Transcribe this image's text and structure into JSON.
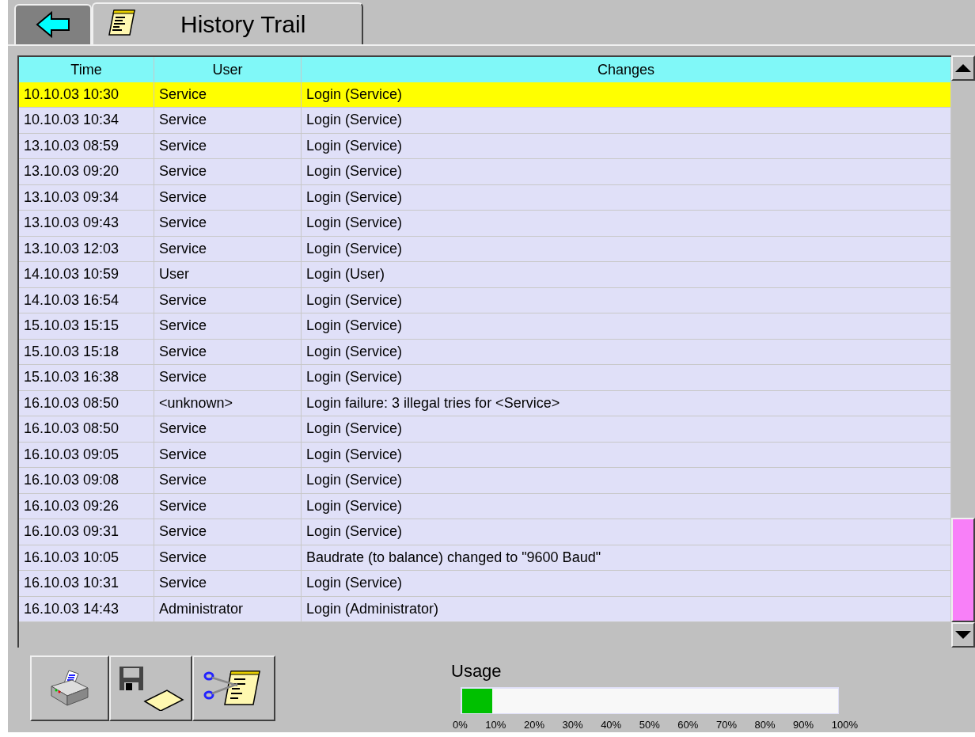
{
  "title_tab": {
    "label": "History Trail"
  },
  "table": {
    "columns": [
      "Time",
      "User",
      "Changes"
    ],
    "rows": [
      {
        "time": "10.10.03 10:30",
        "user": "Service",
        "changes": "Login (Service)",
        "selected": true
      },
      {
        "time": "10.10.03 10:34",
        "user": "Service",
        "changes": "Login (Service)",
        "selected": false
      },
      {
        "time": "13.10.03 08:59",
        "user": "Service",
        "changes": "Login (Service)",
        "selected": false
      },
      {
        "time": "13.10.03 09:20",
        "user": "Service",
        "changes": "Login (Service)",
        "selected": false
      },
      {
        "time": "13.10.03 09:34",
        "user": "Service",
        "changes": "Login (Service)",
        "selected": false
      },
      {
        "time": "13.10.03 09:43",
        "user": "Service",
        "changes": "Login (Service)",
        "selected": false
      },
      {
        "time": "13.10.03 12:03",
        "user": "Service",
        "changes": "Login (Service)",
        "selected": false
      },
      {
        "time": "14.10.03 10:59",
        "user": "User",
        "changes": "Login (User)",
        "selected": false
      },
      {
        "time": "14.10.03 16:54",
        "user": "Service",
        "changes": "Login (Service)",
        "selected": false
      },
      {
        "time": "15.10.03 15:15",
        "user": "Service",
        "changes": "Login (Service)",
        "selected": false
      },
      {
        "time": "15.10.03 15:18",
        "user": "Service",
        "changes": "Login (Service)",
        "selected": false
      },
      {
        "time": "15.10.03 16:38",
        "user": "Service",
        "changes": "Login (Service)",
        "selected": false
      },
      {
        "time": "16.10.03 08:50",
        "user": "<unknown>",
        "changes": "Login failure: 3 illegal tries for <Service>",
        "selected": false
      },
      {
        "time": "16.10.03 08:50",
        "user": "Service",
        "changes": "Login (Service)",
        "selected": false
      },
      {
        "time": "16.10.03 09:05",
        "user": "Service",
        "changes": "Login (Service)",
        "selected": false
      },
      {
        "time": "16.10.03 09:08",
        "user": "Service",
        "changes": "Login (Service)",
        "selected": false
      },
      {
        "time": "16.10.03 09:26",
        "user": "Service",
        "changes": "Login (Service)",
        "selected": false
      },
      {
        "time": "16.10.03 09:31",
        "user": "Service",
        "changes": "Login (Service)",
        "selected": false
      },
      {
        "time": "16.10.03 10:05",
        "user": "Service",
        "changes": "Baudrate (to balance) changed to \"9600 Baud\"",
        "selected": false
      },
      {
        "time": "16.10.03 10:31",
        "user": "Service",
        "changes": "Login (Service)",
        "selected": false
      },
      {
        "time": "16.10.03 14:43",
        "user": "Administrator",
        "changes": "Login (Administrator)",
        "selected": false
      }
    ]
  },
  "usage": {
    "label": "Usage",
    "level": 0.08,
    "ticks": [
      "0%",
      "10%",
      "20%",
      "30%",
      "40%",
      "50%",
      "60%",
      "70%",
      "80%",
      "90%",
      "100%"
    ]
  }
}
